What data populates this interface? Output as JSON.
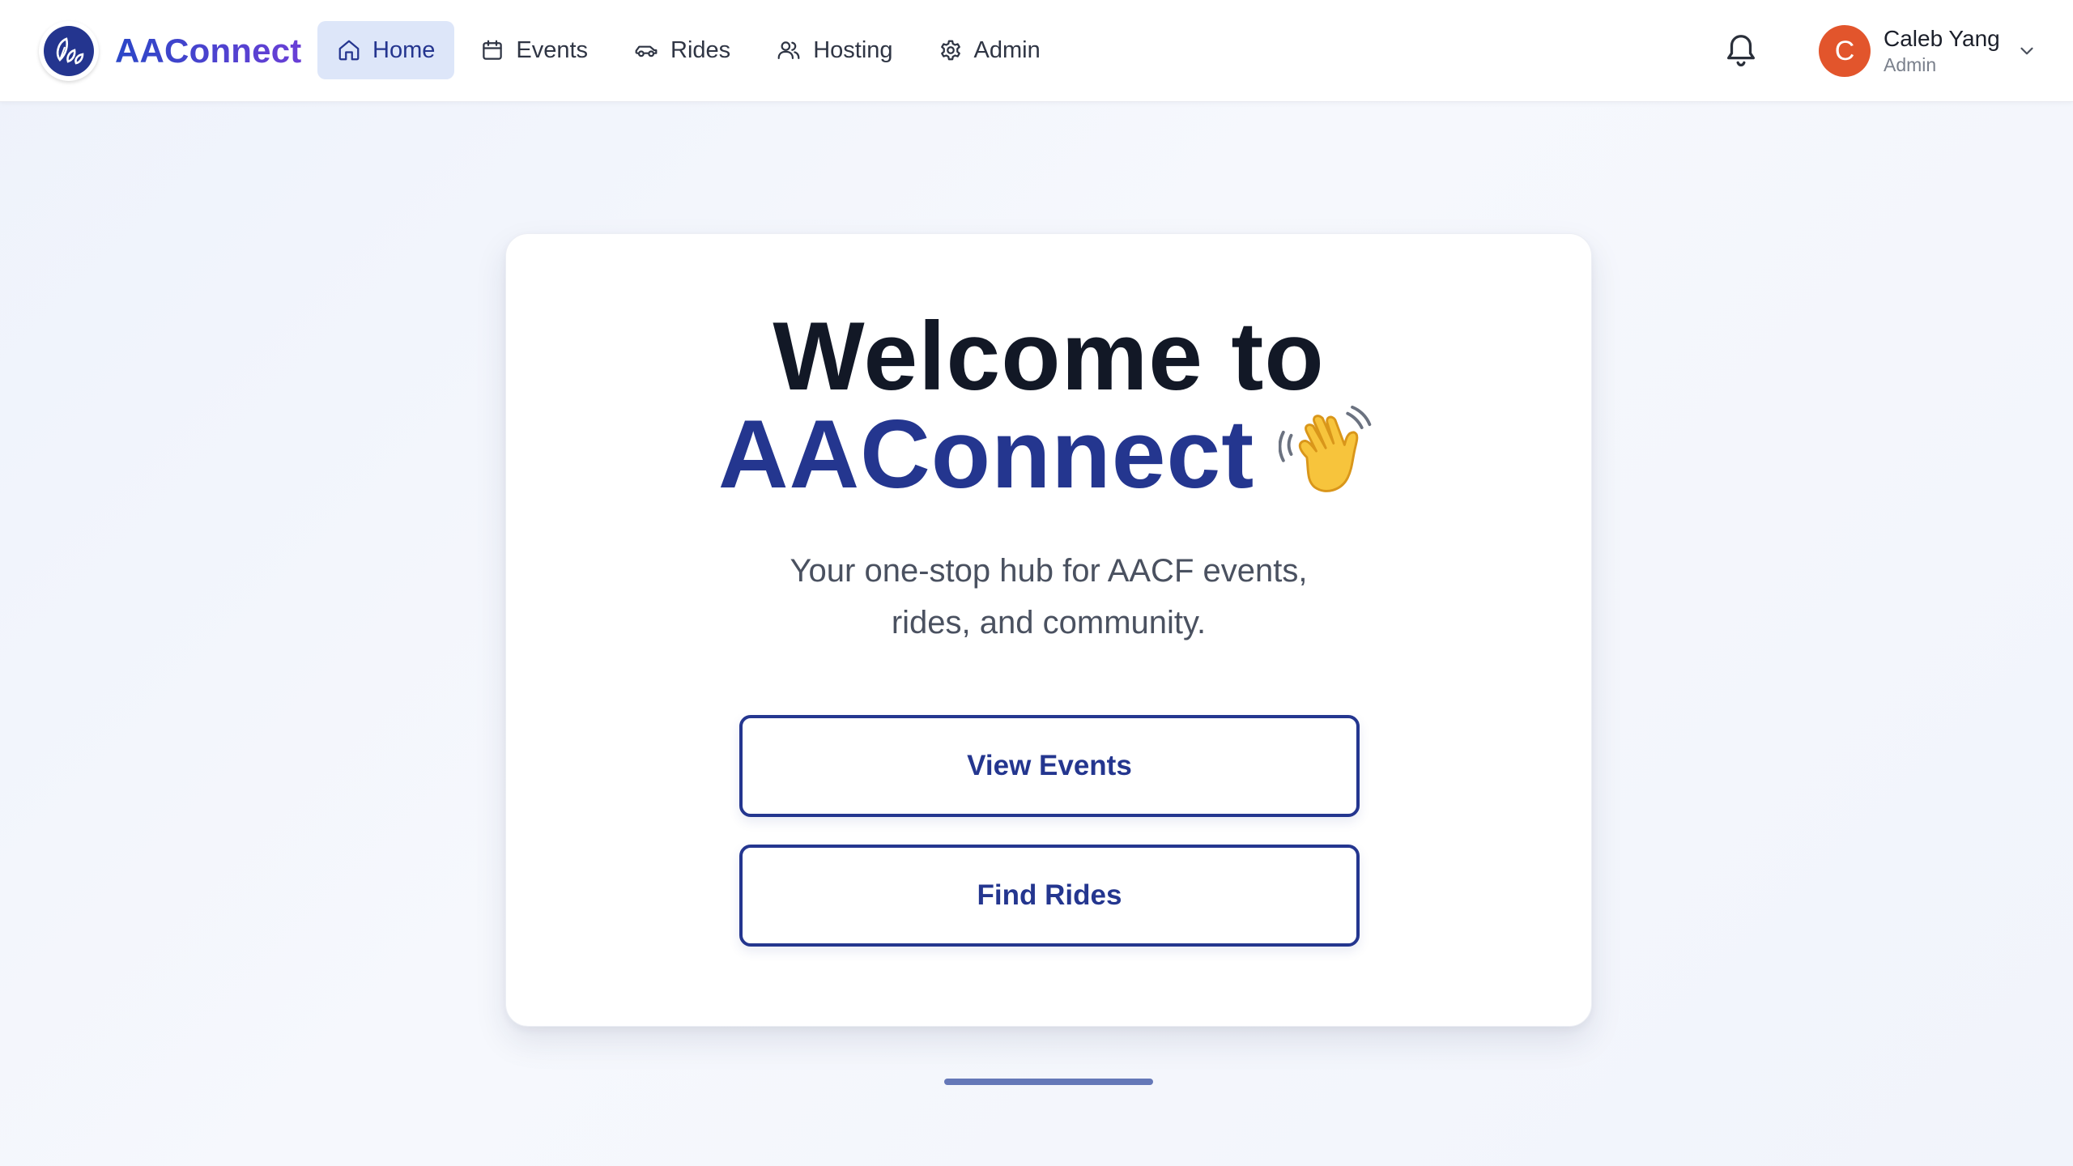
{
  "brand": {
    "name": "AAConnect",
    "logo_icon": "leaf-logo-icon"
  },
  "nav": {
    "items": [
      {
        "label": "Home",
        "icon": "home-icon",
        "active": true
      },
      {
        "label": "Events",
        "icon": "calendar-icon",
        "active": false
      },
      {
        "label": "Rides",
        "icon": "car-icon",
        "active": false
      },
      {
        "label": "Hosting",
        "icon": "users-icon",
        "active": false
      },
      {
        "label": "Admin",
        "icon": "gear-icon",
        "active": false
      }
    ]
  },
  "notifications": {
    "icon": "bell-icon"
  },
  "user": {
    "initial": "C",
    "name": "Caleb Yang",
    "role": "Admin",
    "avatar_color": "#e2552c"
  },
  "hero": {
    "title_line1": "Welcome to",
    "title_brand": "AAConnect",
    "wave_icon": "waving-hand-icon",
    "subtitle_line1": "Your one-stop hub for AACF events,",
    "subtitle_line2": "rides, and community."
  },
  "actions": {
    "view_events": "View Events",
    "find_rides": "Find Rides"
  },
  "colors": {
    "primary": "#24368f",
    "accent_gradient_start": "#2b47c7",
    "accent_gradient_end": "#6a3fd6",
    "active_nav_bg": "#dde6f9"
  }
}
